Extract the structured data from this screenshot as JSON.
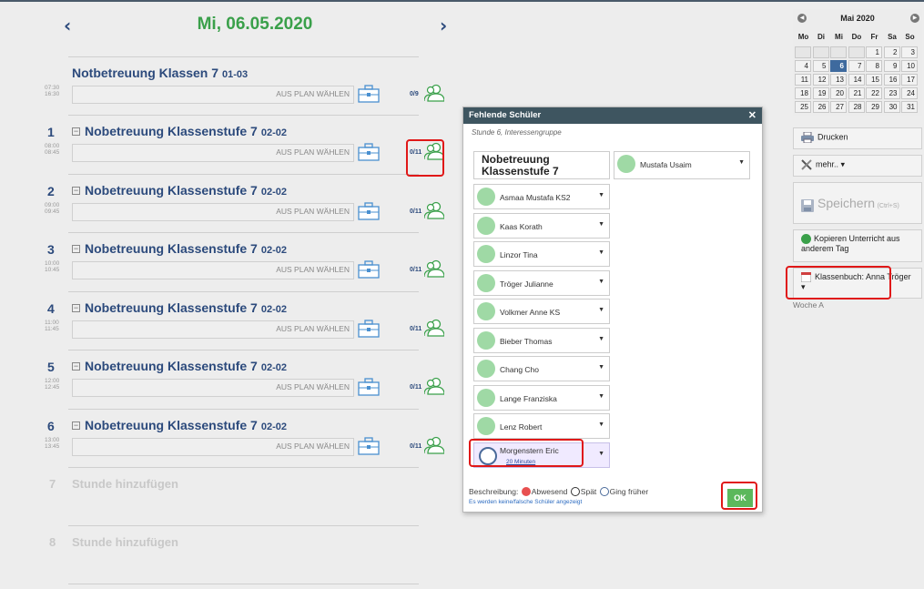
{
  "header": {
    "prev": "‹",
    "next": "›",
    "date": "Mi, 06.05.2020"
  },
  "lessons": [
    {
      "num": "",
      "title": "Notbetreuung Klassen 7",
      "code": "01-03",
      "start": "07:30",
      "end": "16:30",
      "plan": "AUS PLAN WÄHLEN",
      "count": "0/9"
    },
    {
      "num": "1",
      "title": "Nobetreuung Klassenstufe 7",
      "code": "02-02",
      "start": "08:00",
      "end": "08:45",
      "plan": "AUS PLAN WÄHLEN",
      "count": "0/11"
    },
    {
      "num": "2",
      "title": "Nobetreuung Klassenstufe 7",
      "code": "02-02",
      "start": "09:00",
      "end": "09:45",
      "plan": "AUS PLAN WÄHLEN",
      "count": "0/11"
    },
    {
      "num": "3",
      "title": "Nobetreuung Klassenstufe 7",
      "code": "02-02",
      "start": "10:00",
      "end": "10:45",
      "plan": "AUS PLAN WÄHLEN",
      "count": "0/11"
    },
    {
      "num": "4",
      "title": "Nobetreuung Klassenstufe 7",
      "code": "02-02",
      "start": "11:00",
      "end": "11:45",
      "plan": "AUS PLAN WÄHLEN",
      "count": "0/11"
    },
    {
      "num": "5",
      "title": "Nobetreuung Klassenstufe 7",
      "code": "02-02",
      "start": "12:00",
      "end": "12:45",
      "plan": "AUS PLAN WÄHLEN",
      "count": "0/11"
    },
    {
      "num": "6",
      "title": "Nobetreuung Klassenstufe 7",
      "code": "02-02",
      "start": "13:00",
      "end": "13:45",
      "plan": "AUS PLAN WÄHLEN",
      "count": "0/11"
    }
  ],
  "add_lessons": [
    {
      "num": "7",
      "label": "Stunde hinzufügen"
    },
    {
      "num": "8",
      "label": "Stunde hinzufügen"
    }
  ],
  "modal": {
    "title": "Fehlende Schüler",
    "close": "✕",
    "subtitle": "Stunde 6, Interessengruppe",
    "course_line1": "Nobetreuung",
    "course_line2": "Klassenstufe 7",
    "students": [
      "Mustafa Usaim",
      "Asmaa Mustafa KS2",
      "Kaas Korath",
      "Linzor Tina",
      "Tröger Julianne",
      "Volkmer Anne KS",
      "Bieber Thomas",
      "Chang Cho",
      "Lange Franziska",
      "Lenz Robert",
      "Morgenstern Eric"
    ],
    "late_label": "20 Minuten",
    "caret": "▼",
    "legend_label": "Beschreibung:",
    "legend_absent": "Abwesend",
    "legend_late": "Spät",
    "legend_left": "Ging früher",
    "hint": "Es werden keine/falsche Schüler angezeigt",
    "ok": "OK"
  },
  "calendar": {
    "month": "Mai 2020",
    "prev": "◀",
    "next": "▶",
    "dow": [
      "Mo",
      "Di",
      "Mi",
      "Do",
      "Fr",
      "Sa",
      "So"
    ],
    "weeks": [
      [
        "",
        "",
        "",
        "",
        "1",
        "2",
        "3"
      ],
      [
        "4",
        "5",
        "6",
        "7",
        "8",
        "9",
        "10"
      ],
      [
        "11",
        "12",
        "13",
        "14",
        "15",
        "16",
        "17"
      ],
      [
        "18",
        "19",
        "20",
        "21",
        "22",
        "23",
        "24"
      ],
      [
        "25",
        "26",
        "27",
        "28",
        "29",
        "30",
        "31"
      ]
    ],
    "today": "6"
  },
  "right_panel": {
    "print": "Drucken",
    "more": "mehr.. ▾",
    "save": "Speichern",
    "save_hint": "(Ctrl+S)",
    "copy": "Kopieren Unterricht aus anderem Tag",
    "classbook": "Klassenbuch: Anna Tröger ▾",
    "week": "Woche A"
  },
  "colors": {
    "accent_green": "#3aa04a",
    "navy": "#2c4a7c",
    "highlight": "#e01818",
    "modal_header": "#3e5560"
  }
}
